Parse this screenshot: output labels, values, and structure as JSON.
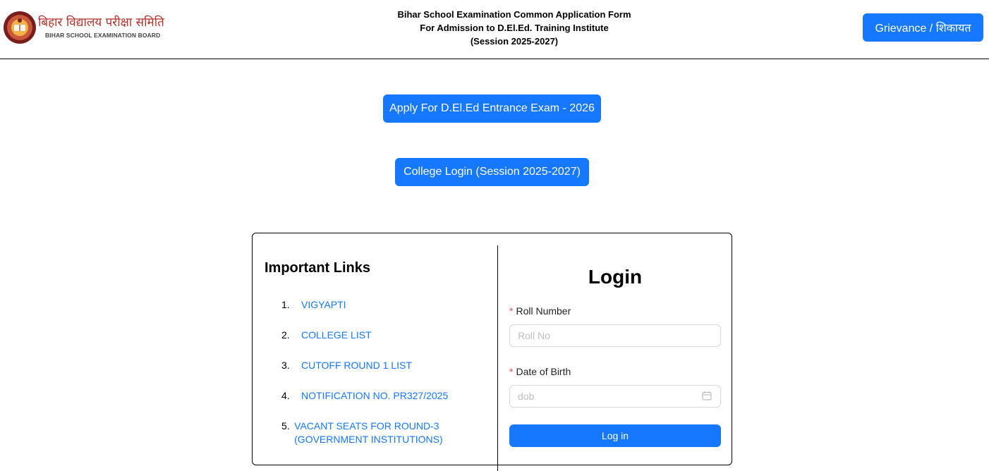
{
  "header": {
    "logo_hindi": "बिहार विद्यालय परीक्षा समिति",
    "logo_english": "BIHAR SCHOOL EXAMINATION BOARD",
    "title_line1": "Bihar School Examination Common Application Form",
    "title_line2": "For Admission to D.El.Ed. Training Institute",
    "title_line3": "(Session 2025-2027)",
    "grievance_label": "Grievance / शिकायत"
  },
  "actions": {
    "apply_label": "Apply For D.El.Ed Entrance Exam - 2026",
    "college_login_label": "College Login (Session 2025-2027)"
  },
  "links": {
    "title": "Important Links",
    "items": [
      {
        "num": "1.",
        "label": "VIGYAPTI"
      },
      {
        "num": "2.",
        "label": "COLLEGE LIST"
      },
      {
        "num": "3.",
        "label": "CUTOFF ROUND 1 LIST"
      },
      {
        "num": "4.",
        "label": "NOTIFICATION NO. PR327/2025"
      },
      {
        "num": "5.",
        "label": "VACANT SEATS FOR ROUND-3 (GOVERNMENT INSTITUTIONS)"
      }
    ]
  },
  "login": {
    "title": "Login",
    "required_mark": "*",
    "roll_label": "Roll Number",
    "roll_placeholder": "Roll No",
    "dob_label": "Date of Birth",
    "dob_placeholder": "dob",
    "submit_label": "Log in"
  },
  "colors": {
    "primary": "#1677ff",
    "logo_red": "#b5322b",
    "required": "#ff4d4f"
  }
}
